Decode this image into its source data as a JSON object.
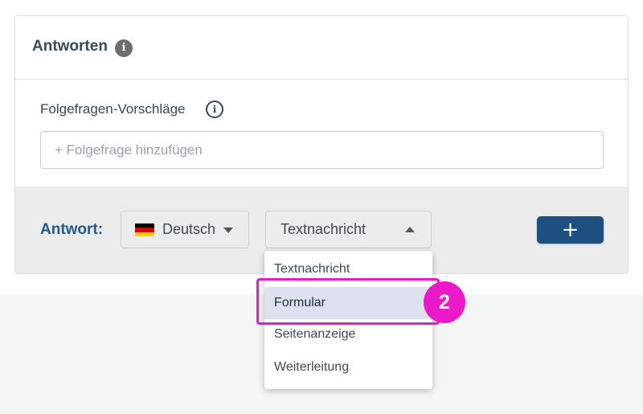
{
  "card": {
    "title": "Antworten",
    "title_info_icon": "info-icon"
  },
  "followups": {
    "label": "Folgefragen-Vorschläge",
    "info_icon": "info-outline-icon",
    "input_value": "",
    "input_placeholder": "+ Folgefrage hinzufügen"
  },
  "answer": {
    "label": "Antwort:",
    "language": {
      "flag_icon": "germany-flag-icon",
      "selected": "Deutsch",
      "caret_icon": "caret-down-icon"
    },
    "type": {
      "selected": "Textnachricht",
      "caret_icon": "caret-up-icon",
      "options": [
        "Textnachricht",
        "Formular",
        "Seitenanzeige",
        "Weiterleitung"
      ],
      "highlighted_option": "Formular"
    },
    "add_button": {
      "label": "+",
      "color": "#1d4f80"
    }
  },
  "annotation": {
    "step_number": "2",
    "color": "#ec19c8"
  },
  "colors": {
    "heading": "#34495e",
    "answer_label": "#1d5a8c",
    "answer_bar_bg": "#ececec",
    "highlight_bg": "#dde2ee"
  }
}
